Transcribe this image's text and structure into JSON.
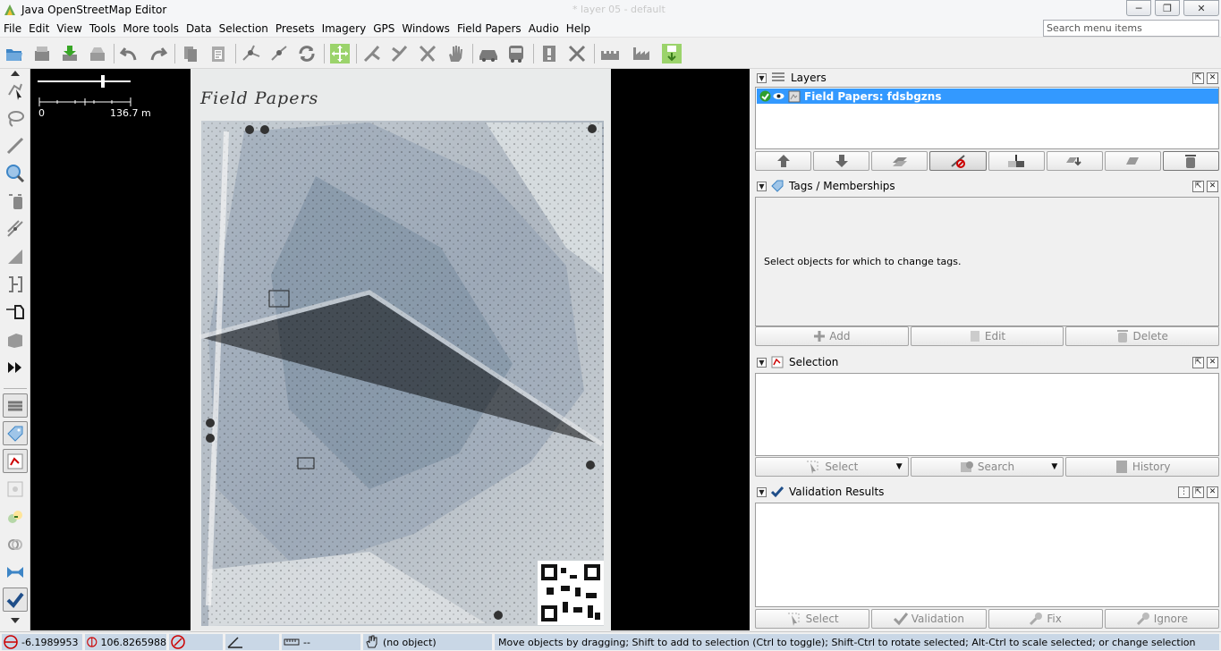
{
  "window": {
    "title": "Java OpenStreetMap Editor",
    "faint_title": "* layer 05 - default"
  },
  "menu": {
    "items": [
      "File",
      "Edit",
      "View",
      "Tools",
      "More tools",
      "Data",
      "Selection",
      "Presets",
      "Imagery",
      "GPS",
      "Windows",
      "Field Papers",
      "Audio",
      "Help"
    ],
    "search_placeholder": "Search menu items"
  },
  "map": {
    "scale_zero": "0",
    "scale_distance": "136.7 m",
    "field_papers_label": "Field Papers"
  },
  "layers": {
    "title": "Layers",
    "active_layer": "Field Papers: fdsbgzns"
  },
  "tags": {
    "title": "Tags / Memberships",
    "empty_message": "Select objects for which to change tags.",
    "add_label": "Add",
    "edit_label": "Edit",
    "delete_label": "Delete"
  },
  "selection": {
    "title": "Selection",
    "select_label": "Select",
    "search_label": "Search",
    "history_label": "History"
  },
  "validation": {
    "title": "Validation Results",
    "select_label": "Select",
    "validation_label": "Validation",
    "fix_label": "Fix",
    "ignore_label": "Ignore"
  },
  "status": {
    "latitude": "-6.1989953",
    "longitude": "106.8265988",
    "distance": "--",
    "object": "(no object)",
    "help": "Move objects by dragging; Shift to add to selection (Ctrl to toggle); Shift-Ctrl to rotate selected; Alt-Ctrl to scale selected; or change selection"
  },
  "colors": {
    "accent": "#3399ff",
    "status_bg": "#c9d7e6",
    "map_bg": "#000000"
  }
}
